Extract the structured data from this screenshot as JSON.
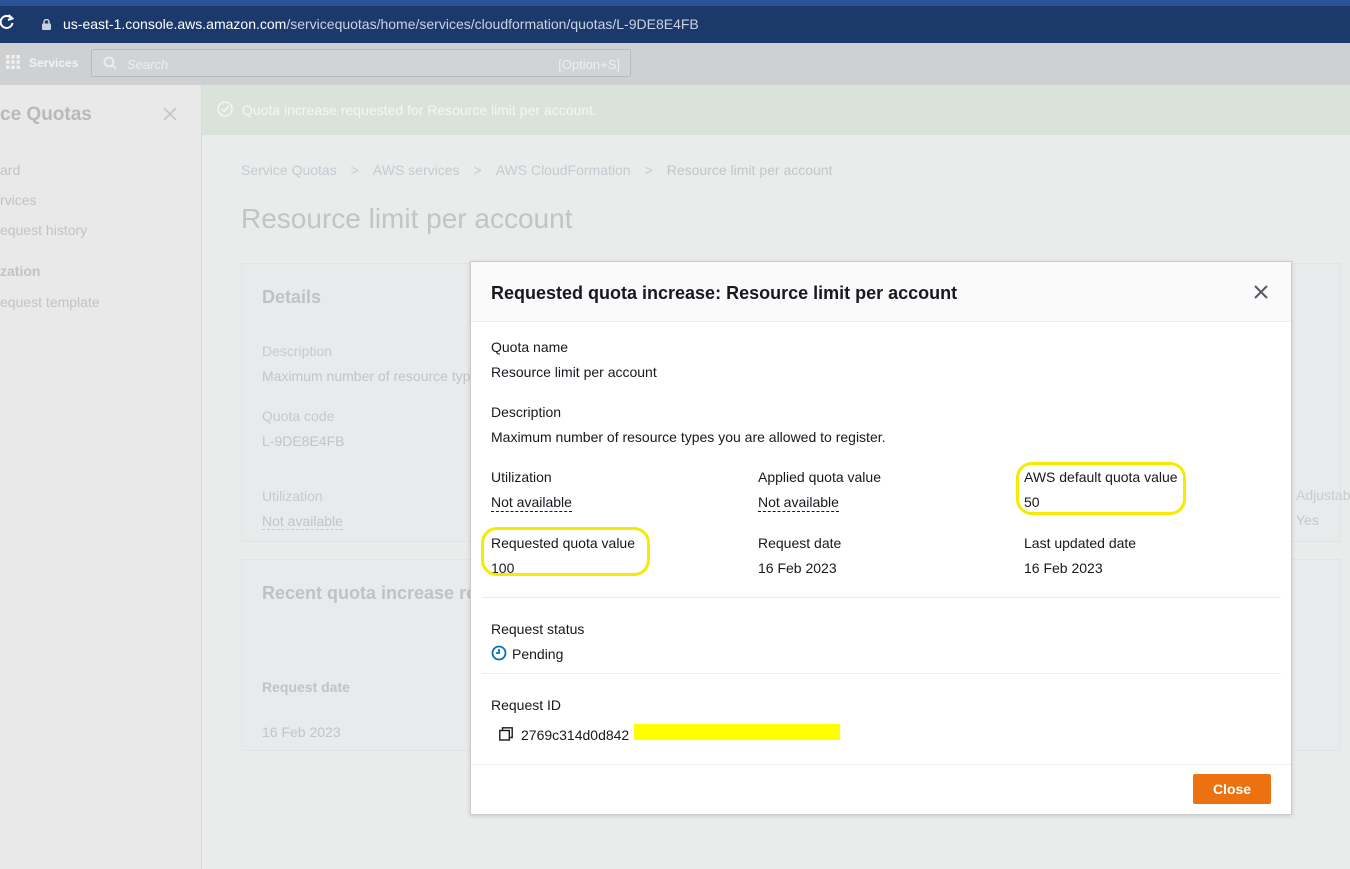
{
  "browser": {
    "url_host": "us-east-1.console.aws.amazon.com",
    "url_path": "/servicequotas/home/services/cloudformation/quotas/L-9DE8E4FB"
  },
  "topnav": {
    "services_label": "Services",
    "search_placeholder": "Search",
    "search_shortcut": "[Option+S]"
  },
  "sidenav": {
    "title": "ce Quotas",
    "items": [
      {
        "label": "ard"
      },
      {
        "label": "rvices"
      },
      {
        "label": "equest history"
      }
    ],
    "section": "zation",
    "section_items": [
      {
        "label": "equest template"
      }
    ]
  },
  "banner": {
    "message": "Quota increase requested for Resource limit per account."
  },
  "breadcrumb": [
    "Service Quotas",
    "AWS services",
    "AWS CloudFormation",
    "Resource limit per account"
  ],
  "page_title": "Resource limit per account",
  "details_panel": {
    "heading": "Details",
    "description_label": "Description",
    "description_value": "Maximum number of resource typ",
    "quota_code_label": "Quota code",
    "quota_code_value": "L-9DE8E4FB",
    "utilization_label": "Utilization",
    "utilization_value": "Not available",
    "adjustable_label": "Adjustab",
    "adjustable_value": "Yes"
  },
  "recent_panel": {
    "heading": "Recent quota increase re",
    "col_request_date": "Request date",
    "row_request_date": "16 Feb 2023"
  },
  "modal": {
    "title": "Requested quota increase: Resource limit per account",
    "quota_name_label": "Quota name",
    "quota_name_value": "Resource limit per account",
    "description_label": "Description",
    "description_value": "Maximum number of resource types you are allowed to register.",
    "utilization_label": "Utilization",
    "utilization_value": "Not available",
    "applied_label": "Applied quota value",
    "applied_value": "Not available",
    "default_label": "AWS default quota value",
    "default_value": "50",
    "requested_label": "Requested quota value",
    "requested_value": "100",
    "request_date_label": "Request date",
    "request_date_value": "16 Feb 2023",
    "last_updated_label": "Last updated date",
    "last_updated_value": "16 Feb 2023",
    "status_label": "Request status",
    "status_value": "Pending",
    "request_id_label": "Request ID",
    "request_id_value": "2769c314d0d842",
    "close_label": "Close"
  },
  "colors": {
    "accent": "#ec7211",
    "highlight": "#f6ea00",
    "status_pending": "#0073bb"
  },
  "icons": [
    "reload-icon",
    "lock-icon",
    "grid-icon",
    "search-icon",
    "close-icon",
    "success-icon",
    "breadcrumb-chevron-icon",
    "pending-clock-icon",
    "copy-icon"
  ]
}
